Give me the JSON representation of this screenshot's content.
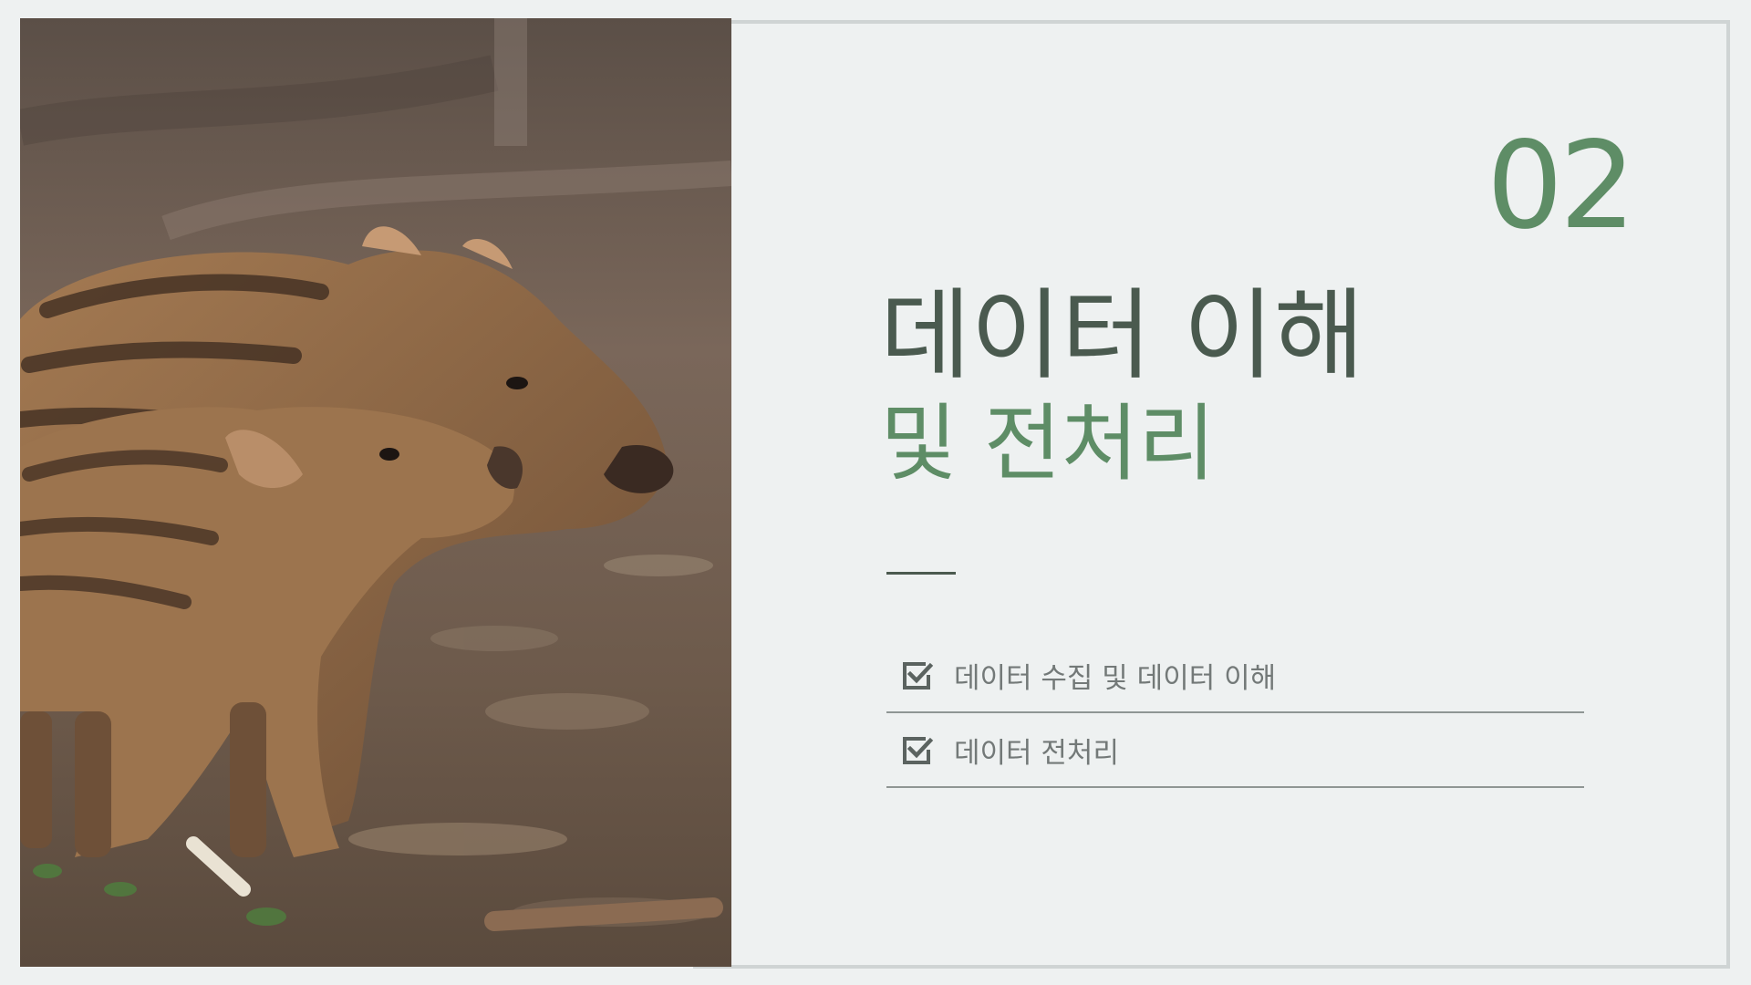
{
  "slide": {
    "section_number": "02",
    "title_main": "데이터 이해",
    "title_sub": "및 전처리",
    "photo_icon": "wild-boar-piglets-photo",
    "check_icon": "checkbox-checked-icon",
    "colors": {
      "accent_green": "#5e8d66",
      "title_dark": "#4a5a4f",
      "background": "#eef1f1",
      "frame": "#cfd4d4",
      "list_text": "#737978"
    }
  },
  "agenda": {
    "items": [
      {
        "label": "데이터 수집 및 데이터 이해"
      },
      {
        "label": "데이터 전처리"
      }
    ]
  }
}
